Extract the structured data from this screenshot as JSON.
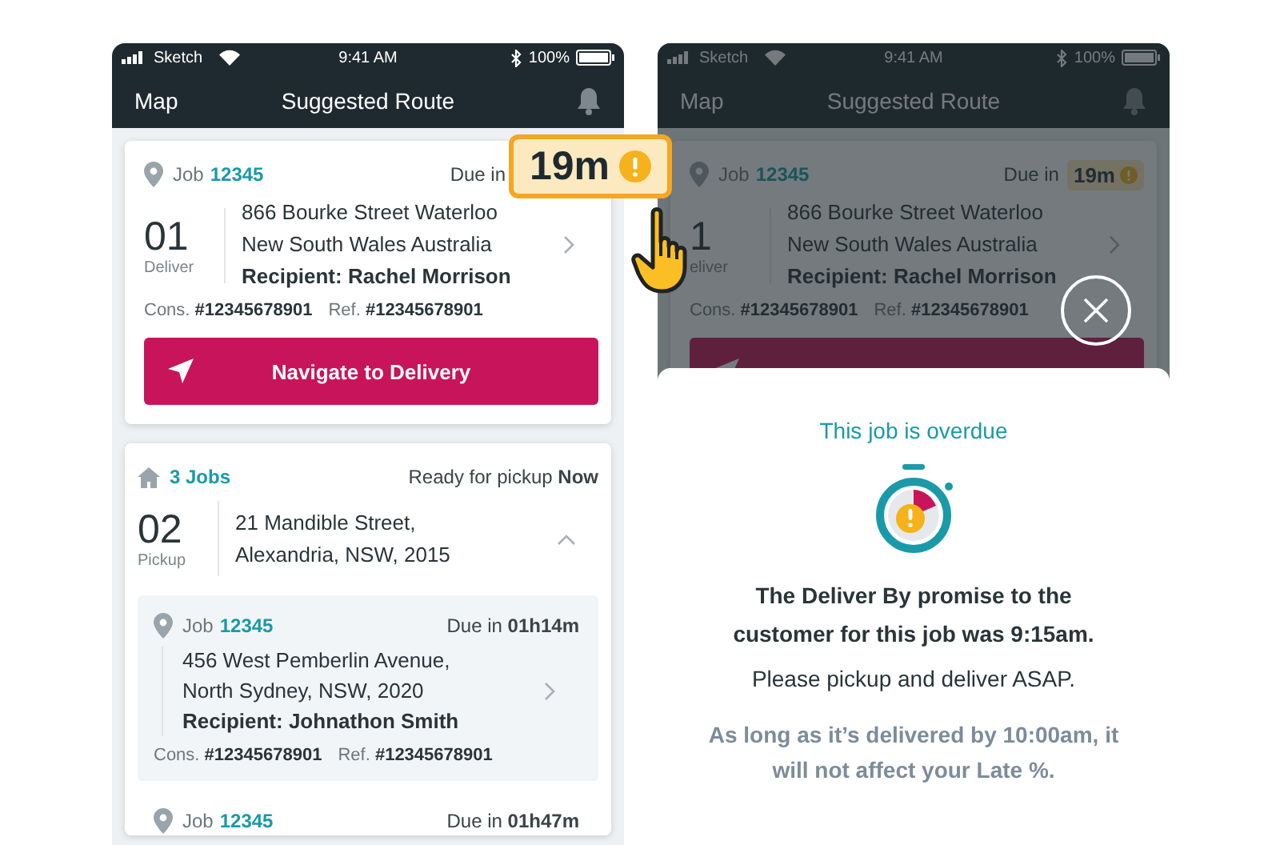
{
  "left_screen": {
    "status_bar": {
      "carrier": "Sketch",
      "time": "9:41 AM",
      "battery": "100%"
    },
    "nav": {
      "left": "Map",
      "title": "Suggested Route"
    },
    "job_card": {
      "job_label": "Job",
      "job_number": "12345",
      "due": {
        "kind": "callout",
        "label": "Due in",
        "value": "19m"
      },
      "number": "01",
      "type": "Deliver",
      "address": [
        "866 Bourke Street Waterloo",
        "New South Wales Australia"
      ],
      "recipient": "Recipient: Rachel Morrison",
      "cons": "Cons. **#12345678901**",
      "ref": "Ref. **#12345678901**",
      "button_label": "Navigate to Delivery"
    },
    "pickup_card": {
      "jobs_count": "3 Jobs",
      "ready": "Ready for pickup **Now**",
      "number": "02",
      "type": "Pickup",
      "address": [
        "21 Mandible Street,",
        "Alexandria, NSW, 2015"
      ],
      "expanded": true,
      "jobs": [
        {
          "job_label": "Job",
          "job_number": "12345",
          "due": "Due in **01h14m**",
          "address": [
            "456 West Pemberlin Avenue,",
            "North Sydney, NSW, 2020"
          ],
          "recipient": "Recipient: Johnathon Smith",
          "cons": "Cons. **#12345678901**",
          "ref": "Ref. **#12345678901**"
        },
        {
          "job_label": "Job",
          "job_number": "12345",
          "due": "Due in **01h47m**"
        }
      ]
    }
  },
  "right_screen": {
    "status_bar": {
      "carrier": "Sketch",
      "time": "9:41 AM",
      "battery": "100%"
    },
    "nav": {
      "left": "Map",
      "title": "Suggested Route"
    },
    "job_card": {
      "job_label": "Job",
      "job_number": "12345",
      "due": {
        "kind": "badge",
        "label": "Due in",
        "value": "19m"
      },
      "number": "1",
      "type": "eliver",
      "address": [
        "866 Bourke Street Waterloo",
        "New South Wales Australia"
      ],
      "recipient": "Recipient: Rachel Morrison",
      "cons": "Cons. **#12345678901**",
      "ref": "Ref. **#12345678901**"
    },
    "sheet": {
      "title": "This job is overdue",
      "promise": "The Deliver By promise to the customer for this job was 9:15am.",
      "instruction": "Please pickup and deliver ASAP.",
      "note": "As long as it’s delivered by 10:00am, it will not affect your Late %."
    }
  }
}
